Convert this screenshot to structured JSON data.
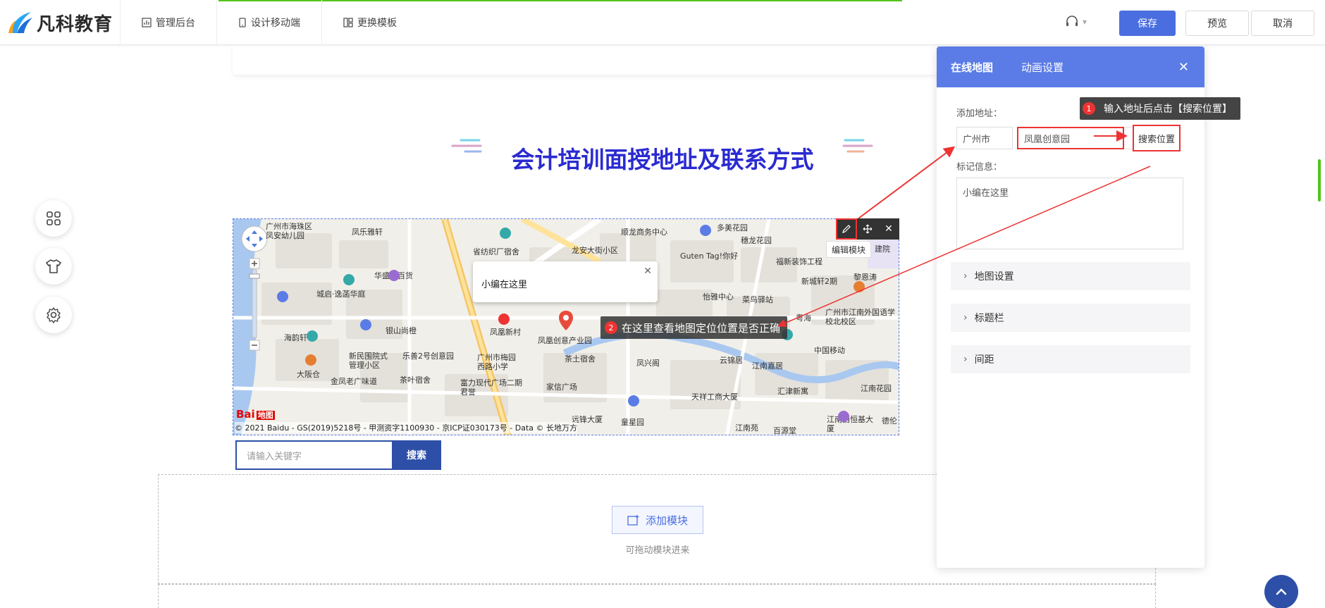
{
  "header": {
    "brand": "凡科教育",
    "nav": [
      {
        "label": "管理后台",
        "icon": "chart-icon"
      },
      {
        "label": "设计移动端",
        "icon": "mobile-icon"
      },
      {
        "label": "更换模板",
        "icon": "template-icon"
      }
    ],
    "save": "保存",
    "preview": "预览",
    "cancel": "取消"
  },
  "page": {
    "section_title": "会计培训面授地址及联系方式",
    "map": {
      "popup_text": "小编在这里",
      "tip2_badge": "2",
      "tip2_text": "在这里查看地图定位位置是否正确",
      "edit_tip": "编辑模块",
      "copyright": "© 2021 Baidu - GS(2019)5218号 - 甲测资字1100930 - 京ICP证030173号 - Data © 长地万方",
      "baidu": "Bai",
      "baidu_suffix": "地图",
      "labels": [
        "广州市海珠区凤安幼儿园",
        "凤乐雅轩",
        "华盛兴百货",
        "城启·逸菡华庭",
        "银山尚橙",
        "海韵轩",
        "新民围院式管理小区",
        "乐善2号创意园",
        "大阪仓",
        "金凤老广味道",
        "茶叶宿舍",
        "广州市梅园西路小学",
        "富力现代广场二期君誉",
        "家信广场",
        "省纺织厂宿舍",
        "龙安大街小区",
        "顺龙商务中心",
        "凤凰新村",
        "凤凰创意产业园",
        "茶土宿舍",
        "凤兴阁",
        "远锋大厦",
        "童星园",
        "天祥工商大厦",
        "江南苑",
        "百源堂",
        "江南嘉居",
        "汇津新寓",
        "云锦居",
        "穗龙花园",
        "福新装饰工程",
        "新城轩2期",
        "怡雅中心",
        "菜鸟驿站",
        "粤海",
        "广州市江南外国语学校北校区",
        "中国移动",
        "江南花园",
        "江南西恒基大厦",
        "黎恩涛",
        "Guten Tag!你好",
        "多美花园",
        "建院",
        "德伦"
      ]
    },
    "search_placeholder": "请输入关键字",
    "search_button": "搜索",
    "add_module": "添加模块",
    "drag_hint": "可拖动模块进来"
  },
  "panel": {
    "tabs": [
      "在线地图",
      "动画设置"
    ],
    "add_address_label": "添加地址：",
    "city": "广州市",
    "address": "凤凰创意园",
    "search_location": "搜索位置",
    "mark_label": "标记信息：",
    "mark_text": "小编在这里",
    "sections": [
      "地图设置",
      "标题栏",
      "间距"
    ],
    "tip1_badge": "1",
    "tip1_text": "输入地址后点击【搜索位置】"
  },
  "colors": {
    "accent": "#4a6ee0",
    "panel_header": "#5b7ce6",
    "title": "#2a2ad1",
    "annotation_red": "#e33"
  }
}
